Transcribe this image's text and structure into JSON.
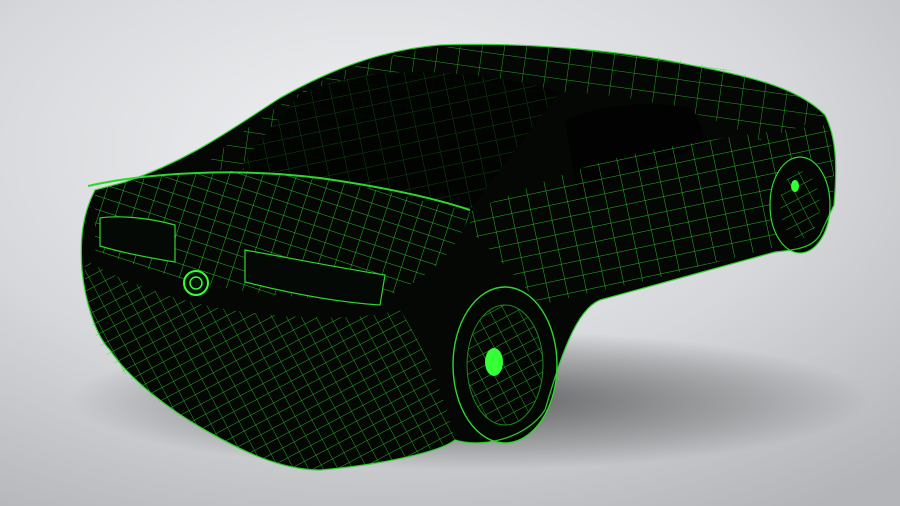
{
  "scene": {
    "subject": "car-wireframe-render",
    "colors": {
      "background_light": "#f0f1f3",
      "background_mid": "#d6d8db",
      "background_dark": "#b3b5b8",
      "body_fill": "#040704",
      "wire_color": "#2fd62f",
      "wire_dim": "#1c8a1c",
      "glow_green": "#35ff35"
    }
  }
}
